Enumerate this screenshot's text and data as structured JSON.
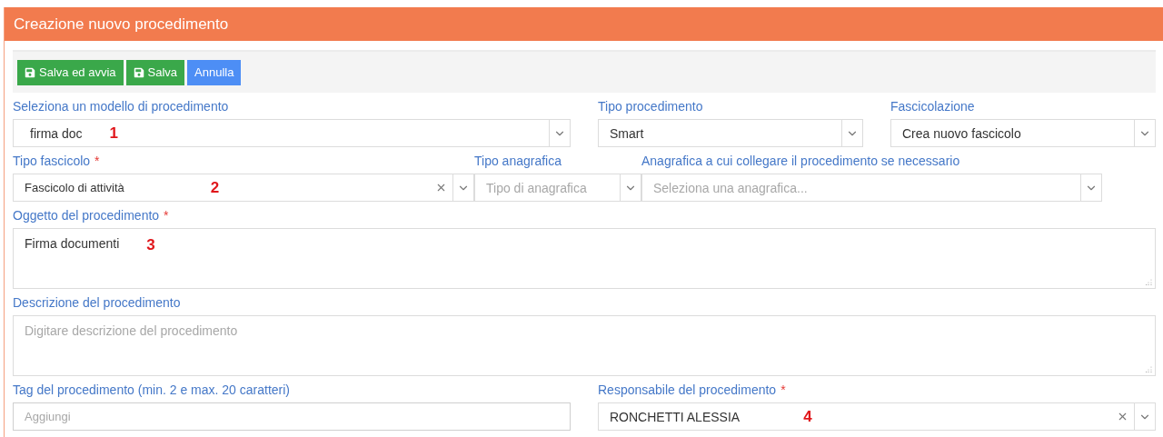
{
  "header": {
    "title": "Creazione nuovo procedimento"
  },
  "toolbar": [
    {
      "label": "Salva ed avvia",
      "kind": "save",
      "color": "#3aa84a"
    },
    {
      "label": "Salva",
      "kind": "save",
      "color": "#3aa84a"
    },
    {
      "label": "Annulla",
      "kind": "plain",
      "color": "#4d8ef5"
    }
  ],
  "rows": [
    [
      {
        "kind": "select",
        "label": "Seleziona un modello di procedimento",
        "value": "firma doc",
        "marker": "1",
        "clearable": false
      },
      {
        "kind": "select",
        "label": "Tipo procedimento",
        "value": "Smart",
        "clearable": false
      },
      {
        "kind": "select",
        "label": "Fascicolazione",
        "value": "Crea nuovo fascicolo",
        "clearable": false
      }
    ],
    [
      {
        "kind": "select",
        "label": "Tipo fascicolo",
        "required_mark": "*",
        "value": "Fascicolo di attività",
        "marker": "2",
        "clearable": true
      },
      {
        "kind": "select",
        "label": "Tipo anagrafica",
        "placeholder": "Tipo di anagrafica",
        "clearable": false
      },
      {
        "kind": "select",
        "label": "Anagrafica a cui collegare il procedimento se necessario",
        "placeholder": "Seleziona una anagrafica...",
        "clearable": false
      }
    ],
    [
      {
        "kind": "textarea",
        "label": "Oggetto del procedimento",
        "required_mark": "*",
        "value": "Firma documenti",
        "marker": "3"
      }
    ],
    [
      {
        "kind": "textarea",
        "label": "Descrizione del procedimento",
        "placeholder": "Digitare descrizione del procedimento"
      }
    ],
    [
      {
        "kind": "input",
        "label": "Tag del procedimento (min. 2 e max. 20 caratteri)",
        "placeholder": "Aggiungi"
      },
      {
        "kind": "select",
        "label": "Responsabile del procedimento",
        "required_mark": "*",
        "value": "RONCHETTI ALESSIA",
        "marker": "4",
        "clearable": true
      }
    ]
  ]
}
